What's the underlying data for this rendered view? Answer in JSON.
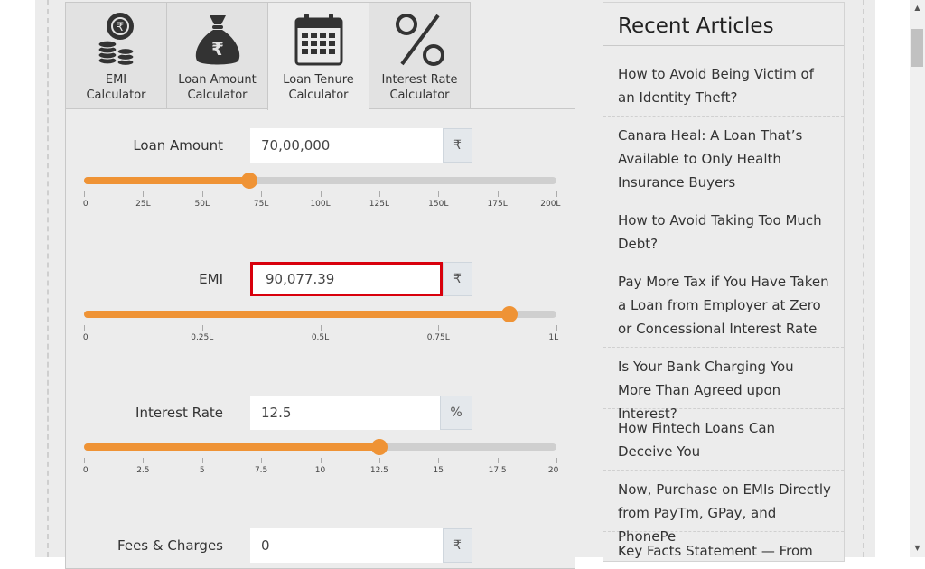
{
  "tabs": [
    {
      "label": "EMI\nCalculator",
      "icon": "coins-icon",
      "active": false
    },
    {
      "label": "Loan Amount\nCalculator",
      "icon": "money-bag-icon",
      "active": false
    },
    {
      "label": "Loan Tenure\nCalculator",
      "icon": "calendar-icon",
      "active": true
    },
    {
      "label": "Interest Rate\nCalculator",
      "icon": "percent-icon",
      "active": false
    }
  ],
  "form": {
    "loan_amount": {
      "label": "Loan Amount",
      "value": "70,00,000",
      "unit": "₹",
      "slider_fraction": 0.35,
      "ticks": [
        "0",
        "25L",
        "50L",
        "75L",
        "100L",
        "125L",
        "150L",
        "175L",
        "200L"
      ]
    },
    "emi": {
      "label": "EMI",
      "value": "90,077.39",
      "unit": "₹",
      "slider_fraction": 0.9,
      "ticks": [
        "0",
        "0.25L",
        "0.5L",
        "0.75L",
        "1L"
      ]
    },
    "interest_rate": {
      "label": "Interest Rate",
      "value": "12.5",
      "unit": "%",
      "slider_fraction": 0.625,
      "ticks": [
        "0",
        "2.5",
        "5",
        "7.5",
        "10",
        "12.5",
        "15",
        "17.5",
        "20"
      ]
    },
    "fees": {
      "label": "Fees & Charges",
      "value": "0",
      "unit": "₹"
    }
  },
  "sidebar": {
    "title": "Recent Articles",
    "articles": [
      "How to Avoid Being Victim of an Identity Theft?",
      "Canara Heal: A Loan That’s Available to Only Health Insurance Buyers",
      "How to Avoid Taking Too Much Debt?",
      "Pay More Tax if You Have Taken a Loan from Employer at Zero or Concessional Interest Rate",
      "Is Your Bank Charging You More Than Agreed upon Interest?",
      "How Fintech Loans Can Deceive You",
      "Now, Purchase on EMIs Directly from PayTm, GPay, and PhonePe",
      "Key Facts Statement — From"
    ]
  },
  "colors": {
    "accent": "#ef9335",
    "focus_border": "#d8000c",
    "track": "#cfcfcf",
    "page_background": "#ececec"
  }
}
